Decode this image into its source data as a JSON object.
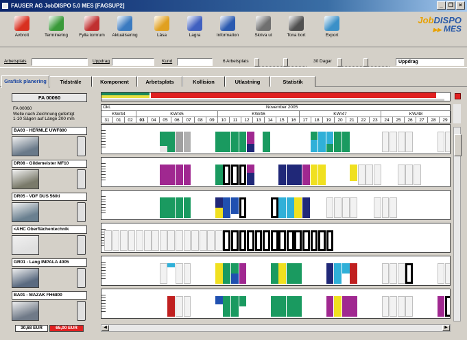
{
  "window": {
    "title": "FAUSER AG JobDISPO 5.0 MES   [FAGSUP2]",
    "controls": [
      "_",
      "❒",
      "×"
    ]
  },
  "toolbar": {
    "buttons": [
      {
        "label": "Avbrott",
        "icon": "stop-icon",
        "color": "#d83020"
      },
      {
        "label": "Terminering",
        "icon": "schedule-grid-icon",
        "color": "#3a9a3a"
      },
      {
        "label": "Fylla tomrum",
        "icon": "fill-gaps-icon",
        "color": "#c03030"
      },
      {
        "label": "Aktualisering",
        "icon": "refresh-icon",
        "color": "#3a7ac0"
      },
      {
        "label": "Läsa",
        "icon": "puzzle-icon",
        "color": "#e0a020"
      },
      {
        "label": "Lagra",
        "icon": "store-icon",
        "color": "#4060c0"
      },
      {
        "label": "Information",
        "icon": "info-icon",
        "color": "#2a5ab0"
      },
      {
        "label": "Skriva ut",
        "icon": "printer-icon",
        "color": "#707070"
      },
      {
        "label": "Tona bort",
        "icon": "hide-icon",
        "color": "#505050"
      },
      {
        "label": "Export",
        "icon": "export-icon",
        "color": "#3a90c8"
      }
    ],
    "logo_line1_a": "Job",
    "logo_line1_b": "DISPO",
    "logo_line2": "MES",
    "logo_mark": "▶▶"
  },
  "filter": {
    "arbetsplats_label": "Arbetsplats",
    "uppdrag_label": "Uppdrag",
    "kund_label": "Kund",
    "arbetsplats_count_label": "6 Arbetsplats",
    "dagar_label": "30 Dagar",
    "dropdown_value": "Uppdrag"
  },
  "tabs": [
    "Grafisk planering",
    "Tidsträle",
    "Komponent",
    "Arbetsplats",
    "Kollision",
    "Utlastning",
    "Statistik"
  ],
  "job": {
    "id": "FA 00060",
    "desc_lines": [
      "FA 00060",
      "Welle nach Zeichnung gefertigt",
      "1-10 Sägen auf Länge 200 mm"
    ]
  },
  "timeline": {
    "month_left": "Okt.",
    "month_right": "November 2005",
    "weeks": [
      "KW/44",
      "KW/45",
      "KW/46",
      "KW/47",
      "KW/48"
    ],
    "days": [
      "31",
      "01",
      "02",
      "03",
      "04",
      "05",
      "06",
      "07",
      "08",
      "09",
      "10",
      "11",
      "12",
      "13",
      "14",
      "15",
      "16",
      "17",
      "18",
      "19",
      "20",
      "21",
      "22",
      "23",
      "24",
      "25",
      "26",
      "27",
      "28",
      "29"
    ]
  },
  "machines": [
    {
      "name": "BA03 - HERMLE UWF800",
      "photo": "#6a7a8a"
    },
    {
      "name": "DR08 - Gildemeister MF10",
      "photo": "#7a7a6a"
    },
    {
      "name": "DR05 - VDF DUS 560ti",
      "photo": "#6a8090"
    },
    {
      "name": "<AHC Oberflächentechnik",
      "photo": "#e0e0e0"
    },
    {
      "name": "GR01 - Lang IMPALA 4005",
      "photo": "#5a6a80"
    },
    {
      "name": "BA01 - MAZAK FH6800",
      "photo": "#707a88"
    }
  ],
  "costs": {
    "value1": "30,68 EUR",
    "value2": "65,00 EUR"
  }
}
